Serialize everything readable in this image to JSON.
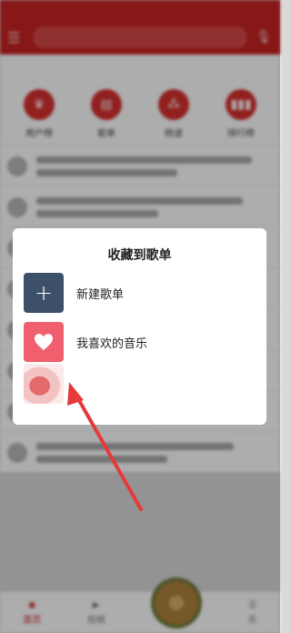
{
  "status_bar": {
    "time": "",
    "signal": ""
  },
  "search": {
    "placeholder": ""
  },
  "tabs": [
    {
      "label": ""
    },
    {
      "label": ""
    },
    {
      "label": ""
    },
    {
      "label": ""
    },
    {
      "label": ""
    }
  ],
  "quick_icons": [
    {
      "label": "用户榜",
      "icon": "crown-icon"
    },
    {
      "label": "歌单",
      "icon": "playlist-icon"
    },
    {
      "label": "杨波",
      "icon": "grid-icon"
    },
    {
      "label": "排行榜",
      "icon": "bar-chart-icon"
    }
  ],
  "bottom_nav": [
    {
      "label": "首页",
      "icon": "home-icon",
      "active": true
    },
    {
      "label": "视频",
      "icon": "video-icon",
      "active": false
    },
    {
      "label": "",
      "icon": "now-playing-disc",
      "active": false
    },
    {
      "label": "乐",
      "icon": "library-icon",
      "active": false
    }
  ],
  "dialog": {
    "title": "收藏到歌单",
    "items": [
      {
        "label": "新建歌单",
        "icon": "plus-icon"
      },
      {
        "label": "我喜欢的音乐",
        "icon": "heart-icon"
      },
      {
        "label": "",
        "icon": "playlist-cover"
      }
    ]
  },
  "colors": {
    "brand_red": "#c92222",
    "new_playlist_bg": "#3d5069",
    "liked_bg": "#f05f6e",
    "arrow": "#e53a3a"
  }
}
